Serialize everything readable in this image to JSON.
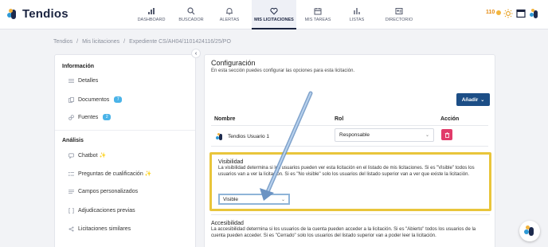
{
  "app": {
    "name": "Tendios"
  },
  "nav": [
    {
      "label": "DASHBOARD",
      "icon": "bar-chart-icon"
    },
    {
      "label": "BUSCADOR",
      "icon": "search-icon"
    },
    {
      "label": "ALERTAS",
      "icon": "bell-icon"
    },
    {
      "label": "MIS LICITACIONES",
      "icon": "heart-icon",
      "active": true
    },
    {
      "label": "MIS TAREAS",
      "icon": "calendar-icon"
    },
    {
      "label": "LISTAS",
      "icon": "list-chart-icon"
    },
    {
      "label": "DIRECTORIO",
      "icon": "directory-icon"
    }
  ],
  "header": {
    "points": "110"
  },
  "breadcrumb": {
    "items": [
      "Tendios",
      "Mis licitaciones",
      "Expediente CS/AH04/1101424116/25/PO"
    ],
    "separator": "/"
  },
  "sidebar": {
    "info_title": "Información",
    "info_items": [
      {
        "label": "Detalles"
      },
      {
        "label": "Documentos",
        "badge": "7"
      },
      {
        "label": "Fuentes",
        "badge": "2"
      }
    ],
    "analysis_title": "Análisis",
    "analysis_items": [
      {
        "label": "Chatbot",
        "sparkle": "✨"
      },
      {
        "label": "Preguntas de cualificación",
        "sparkle": "✨"
      },
      {
        "label": "Campos personalizados"
      },
      {
        "label": "Adjudicaciones previas"
      },
      {
        "label": "Licitaciones similares"
      }
    ]
  },
  "config": {
    "title": "Configuración",
    "subtitle": "En esta sección puedes configurar las opciones para esta licitación.",
    "add_button": "Añadir",
    "columns": {
      "name": "Nombre",
      "role": "Rol",
      "action": "Acción"
    },
    "user": {
      "name": "Tendios Usuario 1",
      "role": "Responsable"
    },
    "visibility": {
      "title": "Visibilidad",
      "text": "La visibilidad determina si los usuarios pueden ver esta licitación en el listado de mis licitaciones. Si es \"Visible\" todos los usuarios van a ver la licitación. Si es \"No visible\" solo los usuarios del listado superior van a ver que existe la licitación.",
      "value": "Visible"
    },
    "accessibility": {
      "title": "Accesibilidad",
      "text": "La accesibilidad determina si los usuarios de la cuenta pueden acceder a la licitación. Si es \"Abierto\" todos los usuarios de la cuenta pueden acceder. Si es \"Cerrado\" solo los usuarios del listado superior van a poder leer la licitación."
    }
  },
  "colors": {
    "brand": "#1b2440",
    "accent": "#1c4e86",
    "highlight": "#e9c53b",
    "danger": "#e13b6a",
    "badge": "#4ab3e8"
  }
}
